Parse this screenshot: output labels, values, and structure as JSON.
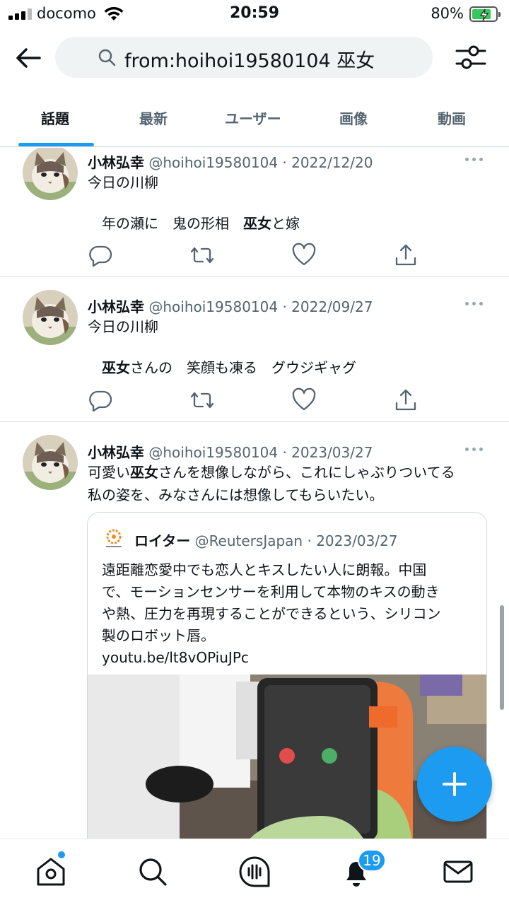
{
  "status_bar": {
    "carrier": "docomo",
    "time": "20:59",
    "battery": "80%",
    "battery_level": 0.8
  },
  "header": {
    "search_query": "from:hoihoi19580104 巫女"
  },
  "tabs": [
    {
      "label": "話題",
      "active": true
    },
    {
      "label": "最新",
      "active": false
    },
    {
      "label": "ユーザー",
      "active": false
    },
    {
      "label": "画像",
      "active": false
    },
    {
      "label": "動画",
      "active": false
    }
  ],
  "tweets": [
    {
      "name": "小林弘幸",
      "handle": "@hoihoi19580104",
      "date": "2022/12/20",
      "line1": "今日の川柳",
      "line2_pre": "年の瀬に　鬼の形相　",
      "line2_kw": "巫女",
      "line2_post": "と嫁"
    },
    {
      "name": "小林弘幸",
      "handle": "@hoihoi19580104",
      "date": "2022/09/27",
      "line1": "今日の川柳",
      "line2_pre": "",
      "line2_kw": "巫女",
      "line2_post": "さんの　笑顔も凍る　グウジギャグ"
    },
    {
      "name": "小林弘幸",
      "handle": "@hoihoi19580104",
      "date": "2023/03/27",
      "line1_pre": "可愛い",
      "line1_kw": "巫女",
      "line1_post": "さんを想像しながら、これにしゃぶりついてる",
      "line2": "私の姿を、みなさんには想像してもらいたい。",
      "quote": {
        "name": "ロイター",
        "handle": "@ReutersJapan",
        "date": "2023/03/27",
        "text": "遠距離恋愛中でも恋人とキスしたい人に朗報。中国\nで、モーションセンサーを利用して本物のキスの動き\nや熱、圧力を再現することができるという、シリコン\n製のロボット唇。\nyoutu.be/lt8vOPiuJPc"
      }
    }
  ],
  "bottom_nav": {
    "items": [
      "home-icon",
      "search-icon",
      "spaces-icon",
      "notifications-icon",
      "messages-icon"
    ],
    "notification_count": "19"
  },
  "colors": {
    "accent": "#1d9bf0",
    "text": "#0f1419",
    "muted": "#536471"
  }
}
